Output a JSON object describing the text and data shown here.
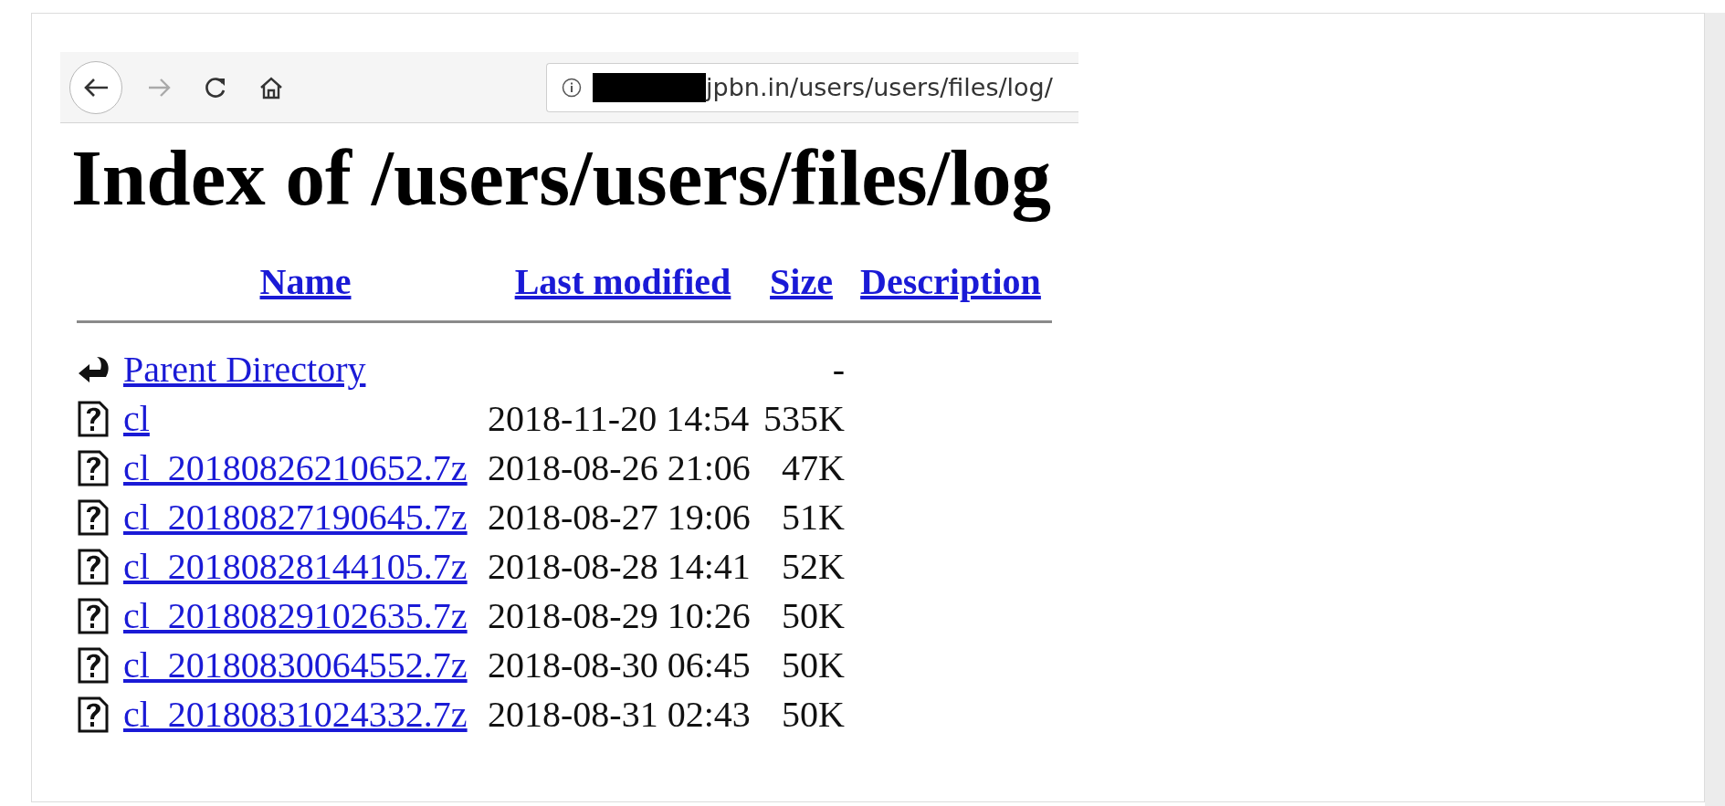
{
  "browser": {
    "url": "jpbn.in/users/users/files/log/"
  },
  "heading": "Index of /users/users/files/log",
  "columns": [
    "Name",
    "Last modified",
    "Size",
    "Description"
  ],
  "rows": [
    {
      "kind": "parent",
      "name": "Parent Directory",
      "size": "-"
    },
    {
      "kind": "file",
      "name": "cl",
      "modified": "2018-11-20 14:54",
      "size": "535K"
    },
    {
      "kind": "file",
      "name": "cl_20180826210652.7z",
      "modified": "2018-08-26 21:06",
      "size": "47K"
    },
    {
      "kind": "file",
      "name": "cl_20180827190645.7z",
      "modified": "2018-08-27 19:06",
      "size": "51K"
    },
    {
      "kind": "file",
      "name": "cl_20180828144105.7z",
      "modified": "2018-08-28 14:41",
      "size": "52K"
    },
    {
      "kind": "file",
      "name": "cl_20180829102635.7z",
      "modified": "2018-08-29 10:26",
      "size": "50K"
    },
    {
      "kind": "file",
      "name": "cl_20180830064552.7z",
      "modified": "2018-08-30 06:45",
      "size": "50K"
    },
    {
      "kind": "file",
      "name": "cl_20180831024332.7z",
      "modified": "2018-08-31 02:43",
      "size": "50K"
    }
  ]
}
